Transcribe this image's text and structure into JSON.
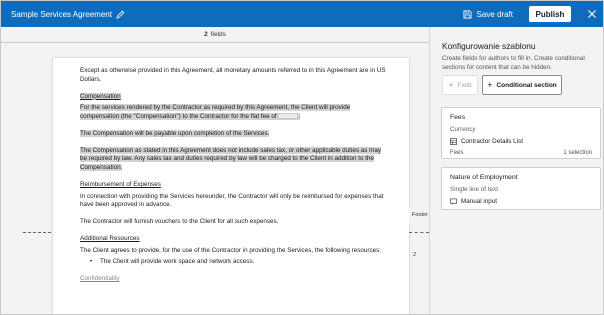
{
  "header": {
    "doc_title": "Sample Services Agreement",
    "save_draft_label": "Save draft",
    "publish_label": "Publish"
  },
  "doc": {
    "fields_count": "2",
    "fields_label": "fields",
    "paragraphs": [
      "Except as otherwise provided in this Agreement, all monetary amounts referred to in this Agreement are in US Dollars.",
      "Compensation",
      "For the services rendered by the Contractor as required by this Agreement, the Client will provide compensation (the \"Compensation\") to the Contractor for the flat fee of",
      "The Compensation will be payable upon completion of the Services.",
      "The Compensation as stated in this Agreement does not include sales tax, or other applicable duties as may be required by law. Any sales tax and duties required by law will be charged to the Client in addition to the Compensation.",
      "Reimbursement of Expenses",
      "In connection with providing the Services hereunder, the Contractor will only be reimbursed for expenses that have been approved in advance.",
      "The Contractor will furnish vouchers to the Client for all such expenses.",
      "Additional Resources",
      "The Client agrees to provide, for the use of the Contractor in providing the Services, the following resources:",
      "The Client will provide work space and network access.",
      "Confidentiality"
    ],
    "fee_suffix": ".",
    "footer_label": "Footer",
    "footer_page": "2"
  },
  "panel": {
    "title": "Konfigurowanie szablonu",
    "description": "Create fields for authors to fill in. Create conditional sections for content that can be hidden.",
    "field_button": "Field",
    "conditional_button": "Conditional section",
    "cards": [
      {
        "title": "Fees",
        "type": "Currency",
        "source": "Contractor Details List",
        "column": "Fees",
        "selection": "1 selection"
      },
      {
        "title": "Nature of Employment",
        "type": "Single line of text",
        "source": "Manual input"
      }
    ]
  },
  "colors": {
    "accent": "#0f6cbd",
    "highlight": "#d2d2d2",
    "panel_bg": "#f3f3f3"
  },
  "icons": [
    "edit-icon",
    "save-icon",
    "close-icon",
    "plus-icon",
    "list-icon",
    "input-icon"
  ]
}
